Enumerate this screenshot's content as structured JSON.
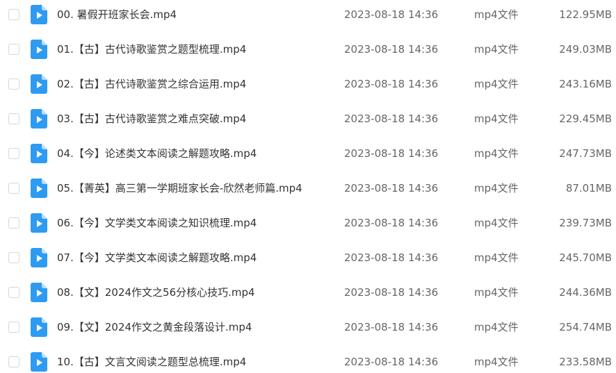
{
  "colors": {
    "icon_fill": "#2e9bf2",
    "icon_fold": "#b9dcfb",
    "text_primary": "#333333",
    "text_secondary": "#666666"
  },
  "files": [
    {
      "name": "00. 暑假开班家长会.mp4",
      "date": "2023-08-18 14:36",
      "type": "mp4文件",
      "size": "122.95MB",
      "icon": "video-file-icon"
    },
    {
      "name": "01.【古】古代诗歌鉴赏之题型梳理.mp4",
      "date": "2023-08-18 14:36",
      "type": "mp4文件",
      "size": "249.03MB",
      "icon": "video-file-icon"
    },
    {
      "name": "02.【古】古代诗歌鉴赏之综合运用.mp4",
      "date": "2023-08-18 14:36",
      "type": "mp4文件",
      "size": "243.16MB",
      "icon": "video-file-icon"
    },
    {
      "name": "03.【古】古代诗歌鉴赏之难点突破.mp4",
      "date": "2023-08-18 14:36",
      "type": "mp4文件",
      "size": "229.45MB",
      "icon": "video-file-icon"
    },
    {
      "name": "04.【今】论述类文本阅读之解题攻略.mp4",
      "date": "2023-08-18 14:36",
      "type": "mp4文件",
      "size": "247.73MB",
      "icon": "video-file-icon"
    },
    {
      "name": "05.【菁英】高三第一学期班家长会-欣然老师篇.mp4",
      "date": "2023-08-18 14:36",
      "type": "mp4文件",
      "size": "87.01MB",
      "icon": "video-file-icon"
    },
    {
      "name": "06.【今】文学类文本阅读之知识梳理.mp4",
      "date": "2023-08-18 14:36",
      "type": "mp4文件",
      "size": "239.73MB",
      "icon": "video-file-icon"
    },
    {
      "name": "07.【今】文学类文本阅读之解题攻略.mp4",
      "date": "2023-08-18 14:36",
      "type": "mp4文件",
      "size": "245.70MB",
      "icon": "video-file-icon"
    },
    {
      "name": "08.【文】2024作文之56分核心技巧.mp4",
      "date": "2023-08-18 14:36",
      "type": "mp4文件",
      "size": "244.36MB",
      "icon": "video-file-icon"
    },
    {
      "name": "09.【文】2024作文之黄金段落设计.mp4",
      "date": "2023-08-18 14:36",
      "type": "mp4文件",
      "size": "254.74MB",
      "icon": "video-file-icon"
    },
    {
      "name": "10.【古】文言文阅读之题型总梳理.mp4",
      "date": "2023-08-18 14:36",
      "type": "mp4文件",
      "size": "233.58MB",
      "icon": "video-file-icon"
    }
  ]
}
